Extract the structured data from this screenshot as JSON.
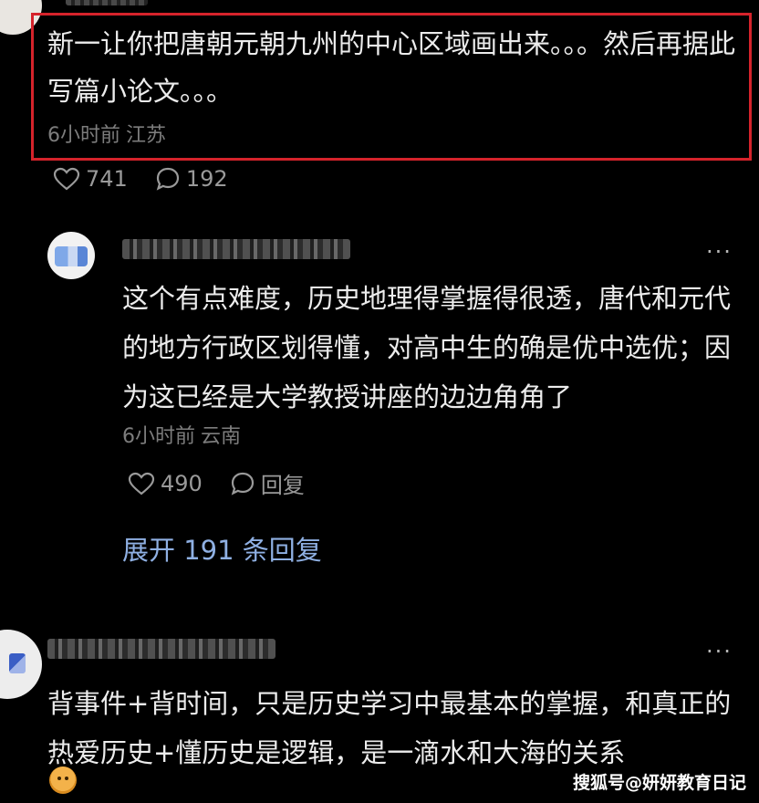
{
  "comments": [
    {
      "text": "新一让你把唐朝元朝九州的中心区域画出来。。。然后再据此写篇小论文。。。",
      "time": "6小时前",
      "location": "江苏",
      "likes": "741",
      "replies": "192"
    }
  ],
  "reply": {
    "text": "这个有点难度，历史地理得掌握得很透，唐代和元代的地方行政区划得懂，对高中生的确是优中选优；因为这已经是大学教授讲座的边边角角了",
    "time": "6小时前",
    "location": "云南",
    "likes": "490",
    "reply_label": "回复",
    "expand_label": "展开 191 条回复"
  },
  "third": {
    "text": "背事件+背时间，只是历史学习中最基本的掌握，和真正的热爱历史+懂历史是逻辑，是一滴水和大海的关系"
  },
  "more_label": "···",
  "watermark": "搜狐号@妍妍教育日记",
  "colors": {
    "highlight": "#d5232b",
    "link": "#8fb0e3",
    "meta": "#7d7d7d"
  },
  "icons": [
    "heart-icon",
    "comment-bubble-icon",
    "more-icon",
    "emoji-icon"
  ]
}
